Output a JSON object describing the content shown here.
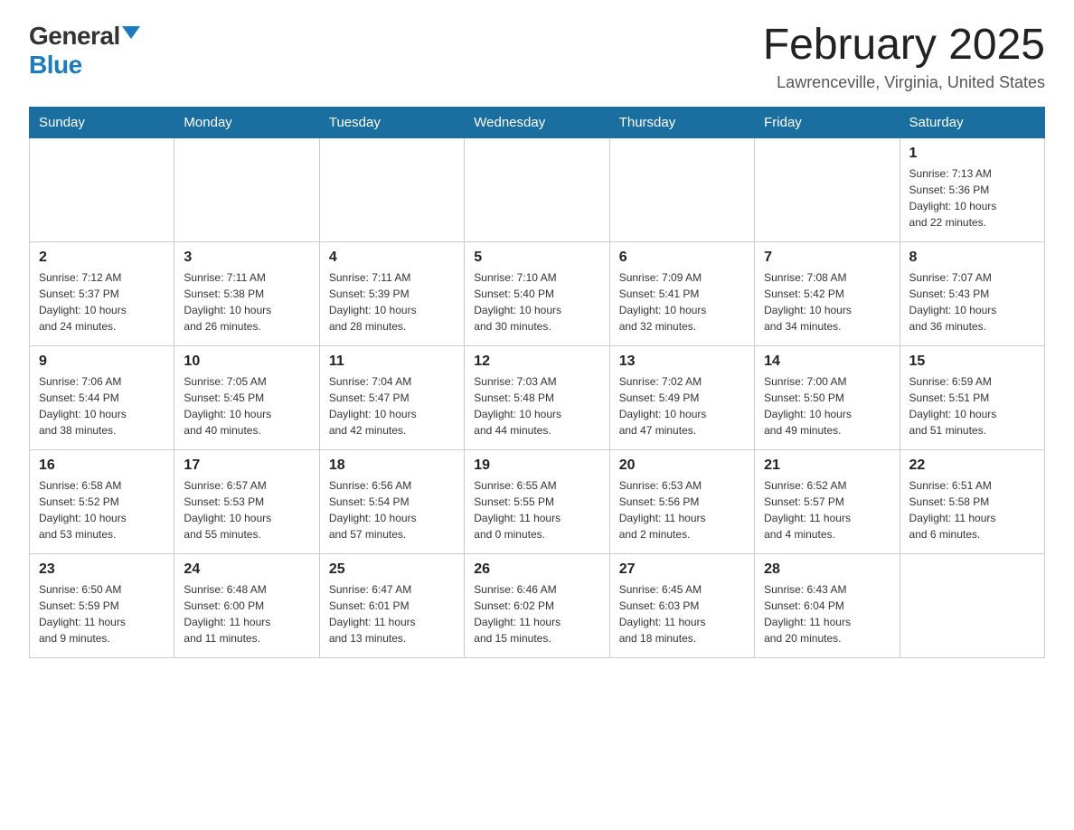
{
  "header": {
    "logo_general": "General",
    "logo_blue": "Blue",
    "month_title": "February 2025",
    "location": "Lawrenceville, Virginia, United States"
  },
  "weekdays": [
    "Sunday",
    "Monday",
    "Tuesday",
    "Wednesday",
    "Thursday",
    "Friday",
    "Saturday"
  ],
  "weeks": [
    [
      {
        "day": "",
        "info": ""
      },
      {
        "day": "",
        "info": ""
      },
      {
        "day": "",
        "info": ""
      },
      {
        "day": "",
        "info": ""
      },
      {
        "day": "",
        "info": ""
      },
      {
        "day": "",
        "info": ""
      },
      {
        "day": "1",
        "info": "Sunrise: 7:13 AM\nSunset: 5:36 PM\nDaylight: 10 hours\nand 22 minutes."
      }
    ],
    [
      {
        "day": "2",
        "info": "Sunrise: 7:12 AM\nSunset: 5:37 PM\nDaylight: 10 hours\nand 24 minutes."
      },
      {
        "day": "3",
        "info": "Sunrise: 7:11 AM\nSunset: 5:38 PM\nDaylight: 10 hours\nand 26 minutes."
      },
      {
        "day": "4",
        "info": "Sunrise: 7:11 AM\nSunset: 5:39 PM\nDaylight: 10 hours\nand 28 minutes."
      },
      {
        "day": "5",
        "info": "Sunrise: 7:10 AM\nSunset: 5:40 PM\nDaylight: 10 hours\nand 30 minutes."
      },
      {
        "day": "6",
        "info": "Sunrise: 7:09 AM\nSunset: 5:41 PM\nDaylight: 10 hours\nand 32 minutes."
      },
      {
        "day": "7",
        "info": "Sunrise: 7:08 AM\nSunset: 5:42 PM\nDaylight: 10 hours\nand 34 minutes."
      },
      {
        "day": "8",
        "info": "Sunrise: 7:07 AM\nSunset: 5:43 PM\nDaylight: 10 hours\nand 36 minutes."
      }
    ],
    [
      {
        "day": "9",
        "info": "Sunrise: 7:06 AM\nSunset: 5:44 PM\nDaylight: 10 hours\nand 38 minutes."
      },
      {
        "day": "10",
        "info": "Sunrise: 7:05 AM\nSunset: 5:45 PM\nDaylight: 10 hours\nand 40 minutes."
      },
      {
        "day": "11",
        "info": "Sunrise: 7:04 AM\nSunset: 5:47 PM\nDaylight: 10 hours\nand 42 minutes."
      },
      {
        "day": "12",
        "info": "Sunrise: 7:03 AM\nSunset: 5:48 PM\nDaylight: 10 hours\nand 44 minutes."
      },
      {
        "day": "13",
        "info": "Sunrise: 7:02 AM\nSunset: 5:49 PM\nDaylight: 10 hours\nand 47 minutes."
      },
      {
        "day": "14",
        "info": "Sunrise: 7:00 AM\nSunset: 5:50 PM\nDaylight: 10 hours\nand 49 minutes."
      },
      {
        "day": "15",
        "info": "Sunrise: 6:59 AM\nSunset: 5:51 PM\nDaylight: 10 hours\nand 51 minutes."
      }
    ],
    [
      {
        "day": "16",
        "info": "Sunrise: 6:58 AM\nSunset: 5:52 PM\nDaylight: 10 hours\nand 53 minutes."
      },
      {
        "day": "17",
        "info": "Sunrise: 6:57 AM\nSunset: 5:53 PM\nDaylight: 10 hours\nand 55 minutes."
      },
      {
        "day": "18",
        "info": "Sunrise: 6:56 AM\nSunset: 5:54 PM\nDaylight: 10 hours\nand 57 minutes."
      },
      {
        "day": "19",
        "info": "Sunrise: 6:55 AM\nSunset: 5:55 PM\nDaylight: 11 hours\nand 0 minutes."
      },
      {
        "day": "20",
        "info": "Sunrise: 6:53 AM\nSunset: 5:56 PM\nDaylight: 11 hours\nand 2 minutes."
      },
      {
        "day": "21",
        "info": "Sunrise: 6:52 AM\nSunset: 5:57 PM\nDaylight: 11 hours\nand 4 minutes."
      },
      {
        "day": "22",
        "info": "Sunrise: 6:51 AM\nSunset: 5:58 PM\nDaylight: 11 hours\nand 6 minutes."
      }
    ],
    [
      {
        "day": "23",
        "info": "Sunrise: 6:50 AM\nSunset: 5:59 PM\nDaylight: 11 hours\nand 9 minutes."
      },
      {
        "day": "24",
        "info": "Sunrise: 6:48 AM\nSunset: 6:00 PM\nDaylight: 11 hours\nand 11 minutes."
      },
      {
        "day": "25",
        "info": "Sunrise: 6:47 AM\nSunset: 6:01 PM\nDaylight: 11 hours\nand 13 minutes."
      },
      {
        "day": "26",
        "info": "Sunrise: 6:46 AM\nSunset: 6:02 PM\nDaylight: 11 hours\nand 15 minutes."
      },
      {
        "day": "27",
        "info": "Sunrise: 6:45 AM\nSunset: 6:03 PM\nDaylight: 11 hours\nand 18 minutes."
      },
      {
        "day": "28",
        "info": "Sunrise: 6:43 AM\nSunset: 6:04 PM\nDaylight: 11 hours\nand 20 minutes."
      },
      {
        "day": "",
        "info": ""
      }
    ]
  ]
}
